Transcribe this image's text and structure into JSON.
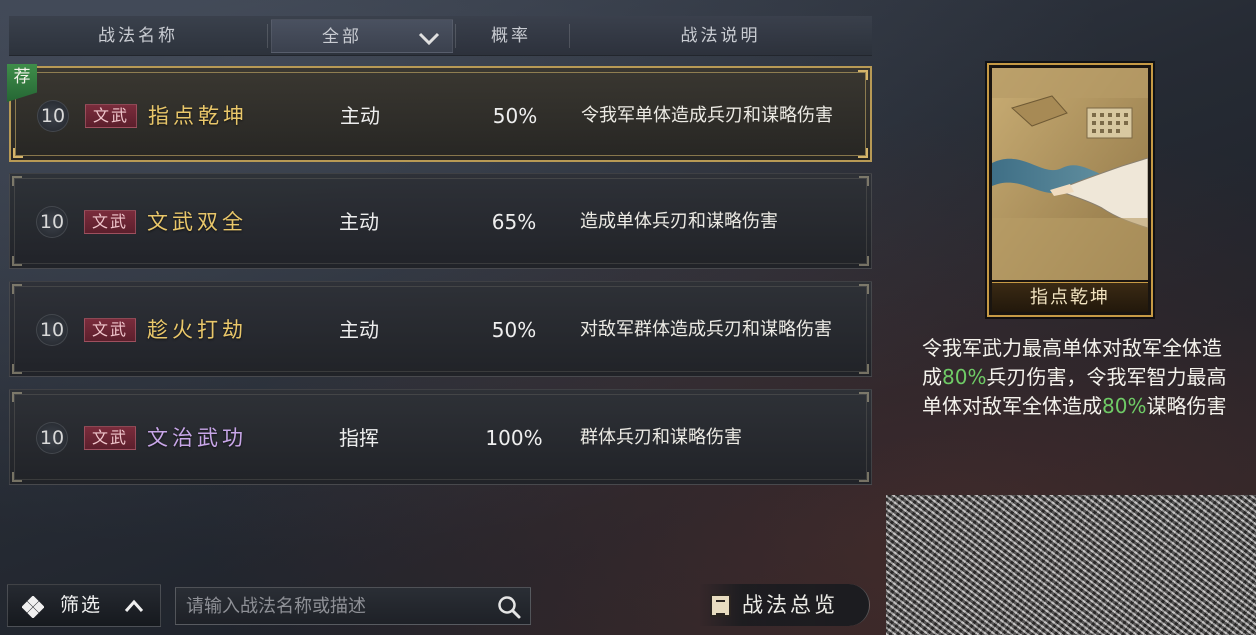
{
  "header": {
    "col_name": "战法名称",
    "filter_value": "全部",
    "col_rate": "概率",
    "col_desc": "战法说明"
  },
  "skills": [
    {
      "level": "10",
      "tag": "文武",
      "name": "指点乾坤",
      "type": "主动",
      "rate": "50%",
      "desc": "令我军单体造成兵刃和谋略伤害",
      "recommended": true,
      "recommend_label": "荐",
      "name_color": "#e9c76a"
    },
    {
      "level": "10",
      "tag": "文武",
      "name": "文武双全",
      "type": "主动",
      "rate": "65%",
      "desc": "造成单体兵刃和谋略伤害",
      "name_color": "#e9c76a"
    },
    {
      "level": "10",
      "tag": "文武",
      "name": "趁火打劫",
      "type": "主动",
      "rate": "50%",
      "desc": "对敌军群体造成兵刃和谋略伤害",
      "name_color": "#e9c76a"
    },
    {
      "level": "10",
      "tag": "文武",
      "name": "文治武功",
      "type": "指挥",
      "rate": "100%",
      "desc": "群体兵刃和谋略伤害",
      "name_color": "#c8a6e8"
    }
  ],
  "detail": {
    "card_name": "指点乾坤",
    "desc_part1": "令我军武力最高单体对敌军全体造成",
    "highlight1": "80%",
    "desc_part2": "兵刃伤害，令我军智力最高单体对敌军全体造成",
    "highlight2": "80%",
    "desc_part3": "谋略伤害",
    "highlight_color": "#6fcb66"
  },
  "bottom": {
    "filter_label": "筛选",
    "search_placeholder": "请输入战法名称或描述",
    "search_value": "",
    "overview_label": "战法总览"
  }
}
